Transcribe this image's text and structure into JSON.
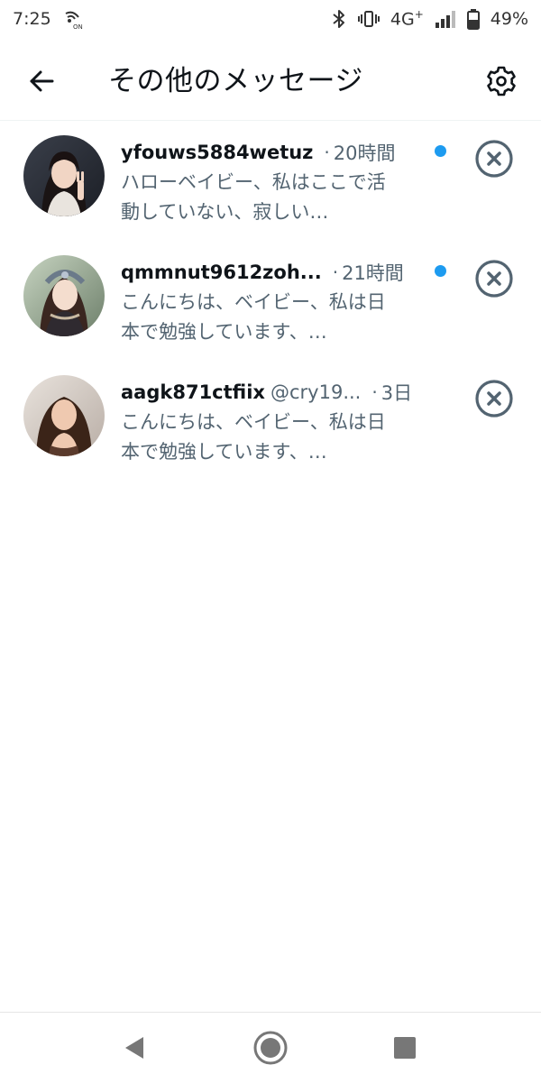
{
  "status_bar": {
    "time": "7:25",
    "network": "4G",
    "battery": "49%",
    "icons": [
      "nfc-on-icon",
      "bluetooth-icon",
      "vibrate-icon",
      "signal-icon",
      "battery-icon"
    ],
    "nfc_label": "ON"
  },
  "header": {
    "title": "その他のメッセージ",
    "back_icon": "back-arrow-icon",
    "settings_icon": "gear-icon"
  },
  "messages": [
    {
      "name": "yfouws5884wetuz",
      "handle": "",
      "time": "20時間",
      "unread": true,
      "preview": "ハローベイビー、私はここで活動していない、寂しい…",
      "avatar_icon": "avatar-photo-1"
    },
    {
      "name": "qmmnut9612zoh...",
      "handle": "",
      "time": "21時間",
      "unread": true,
      "preview": "こんにちは、ベイビー、私は日本で勉強しています、…",
      "avatar_icon": "avatar-photo-2"
    },
    {
      "name": "aagk871ctfiix",
      "handle": "@cry19...",
      "time": "3日",
      "unread": false,
      "preview": "こんにちは、ベイビー、私は日本で勉強しています、…",
      "avatar_icon": "avatar-photo-3"
    }
  ],
  "separator": "·",
  "colors": {
    "accent": "#1d9bf0",
    "text_primary": "#0f1419",
    "text_secondary": "#536471",
    "dismiss_icon": "#536471"
  },
  "nav": {
    "back_icon": "nav-back-icon",
    "home_icon": "nav-home-icon",
    "recents_icon": "nav-recents-icon"
  }
}
